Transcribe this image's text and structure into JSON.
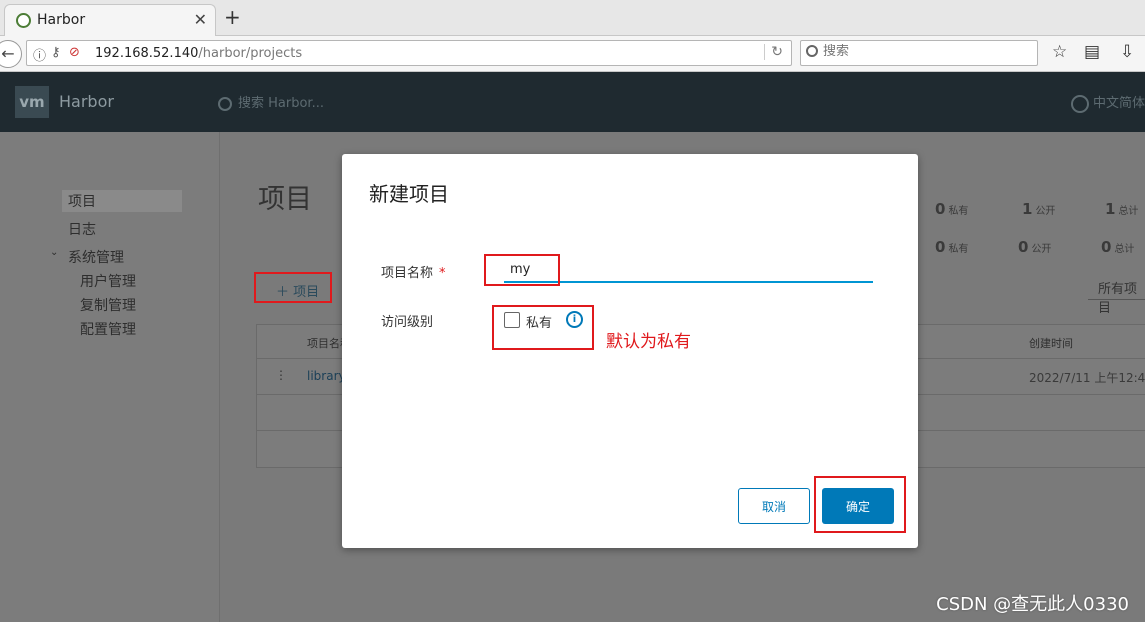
{
  "browser": {
    "tab_title": "Harbor",
    "tab_close": "✕",
    "new_tab": "+",
    "url_host": "192.168.52.140",
    "url_path": "/harbor/projects",
    "search_placeholder": "搜索"
  },
  "header": {
    "logo": "vm",
    "brand": "Harbor",
    "search_placeholder": "搜索 Harbor...",
    "language": "中文简体"
  },
  "sidebar": {
    "items": [
      "项目",
      "日志",
      "系统管理"
    ],
    "sub_items": [
      "用户管理",
      "复制管理",
      "配置管理"
    ]
  },
  "main": {
    "title": "项目",
    "add_project": "项目",
    "filter": "所有项目",
    "stats_row1": [
      {
        "count": "0",
        "label": "私有"
      },
      {
        "count": "1",
        "label": "公开"
      },
      {
        "count": "1",
        "label": "总计"
      }
    ],
    "stats_row2": [
      {
        "count": "0",
        "label": "私有"
      },
      {
        "count": "0",
        "label": "公开"
      },
      {
        "count": "0",
        "label": "总计"
      }
    ],
    "table": {
      "columns": [
        "项目名称",
        "创建时间"
      ],
      "rows": [
        {
          "name": "library",
          "created": "2022/7/11 上午12:4"
        }
      ]
    }
  },
  "modal": {
    "title": "新建项目",
    "name_label": "项目名称",
    "required_mark": "*",
    "name_value": "my",
    "access_label": "访问级别",
    "private_label": "私有",
    "private_checked": false,
    "annotation": "默认为私有",
    "cancel": "取消",
    "ok": "确定"
  },
  "watermark": "CSDN @查无此人0330"
}
